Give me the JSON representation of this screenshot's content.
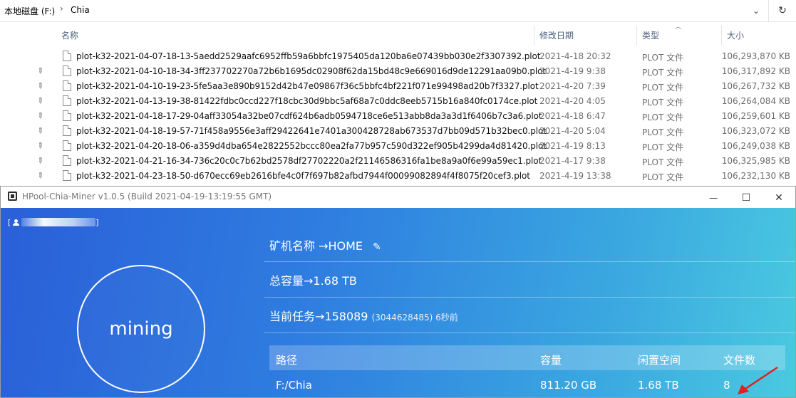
{
  "explorer": {
    "breadcrumb": {
      "drive": "本地磁盘 (F:)",
      "separator": "›",
      "folder": "Chia"
    },
    "columns": {
      "name": "名称",
      "date": "修改日期",
      "type": "类型",
      "size": "大小"
    },
    "files": [
      {
        "name": "plot-k32-2021-04-07-18-13-5aedd2529aafc6952ffb59a6bbfc1975405da120ba6e07439bb030e2f3307392.plot",
        "date": "2021-4-18 20:32",
        "type": "PLOT 文件",
        "size": "106,293,870 KB",
        "pinned": false
      },
      {
        "name": "plot-k32-2021-04-10-18-34-3ff237702270a72b6b1695dc02908f62da15bd48c9e669016d9de12291aa09b0.plot",
        "date": "2021-4-19 9:38",
        "type": "PLOT 文件",
        "size": "106,317,892 KB",
        "pinned": true
      },
      {
        "name": "plot-k32-2021-04-10-19-23-5fe5aa3e890b9152d42b47e09867f36c5bbfc4bf221f071e99498ad20b7f3327.plot",
        "date": "2021-4-20 7:39",
        "type": "PLOT 文件",
        "size": "106,267,732 KB",
        "pinned": true
      },
      {
        "name": "plot-k32-2021-04-13-19-38-81422fdbc0ccd227f18cbc30d9bbc5af68a7c0ddc8eeb5715b16a840fc0174ce.plot",
        "date": "2021-4-20 4:05",
        "type": "PLOT 文件",
        "size": "106,264,084 KB",
        "pinned": true
      },
      {
        "name": "plot-k32-2021-04-18-17-29-04aff33054a32be07cdf624b6adb0594718ce6e513abb8da3a3d1f6406b7c3a6.plot",
        "date": "2021-4-18 6:47",
        "type": "PLOT 文件",
        "size": "106,259,601 KB",
        "pinned": true
      },
      {
        "name": "plot-k32-2021-04-18-19-57-71f458a9556e3aff29422641e7401a300428728ab673537d7bb09d571b32bec0.plot",
        "date": "2021-4-20 5:04",
        "type": "PLOT 文件",
        "size": "106,323,072 KB",
        "pinned": true
      },
      {
        "name": "plot-k32-2021-04-20-18-06-a359d4dba654e2822552bccc80ea2fa77b957c590d322ef905b4299da4d81420.plot",
        "date": "2021-4-19 8:13",
        "type": "PLOT 文件",
        "size": "106,249,038 KB",
        "pinned": true
      },
      {
        "name": "plot-k32-2021-04-21-16-34-736c20c0c7b62bd2578df27702220a2f21146586316fa1be8a9a0f6e99a59ec1.plot",
        "date": "2021-4-17 9:38",
        "type": "PLOT 文件",
        "size": "106,325,985 KB",
        "pinned": true
      },
      {
        "name": "plot-k32-2021-04-23-18-50-d670ecc69eb2616bfe4c0f7f697b82afbd7944f00099082894f4f8075f20cef3.plot",
        "date": "2021-4-19 13:38",
        "type": "PLOT 文件",
        "size": "106,232,130 KB",
        "pinned": true
      }
    ]
  },
  "miner": {
    "title": "HPool-Chia-Miner v1.0.5 (Build 2021-04-19-13:19:55 GMT)",
    "user_prefix": "[",
    "user_suffix": "]",
    "status": "mining",
    "miner_name": "矿机名称 →HOME",
    "capacity": "总容量→1.68 TB",
    "task": "当前任务→158089",
    "task_detail": "(3044628485) 6秒前",
    "table": {
      "headers": {
        "path": "路径",
        "capacity": "容量",
        "free": "闲置空间",
        "files": "文件数"
      },
      "rows": [
        {
          "path": "F:/Chia",
          "capacity": "811.20 GB",
          "free": "1.68 TB",
          "files": "8"
        }
      ]
    },
    "window_controls": {
      "minimize": "—",
      "maximize": "☐",
      "close": "✕"
    }
  },
  "colors": {
    "gradient_start": "#2a5fd8",
    "gradient_end": "#4ac9e0",
    "arrow": "#e02020"
  }
}
